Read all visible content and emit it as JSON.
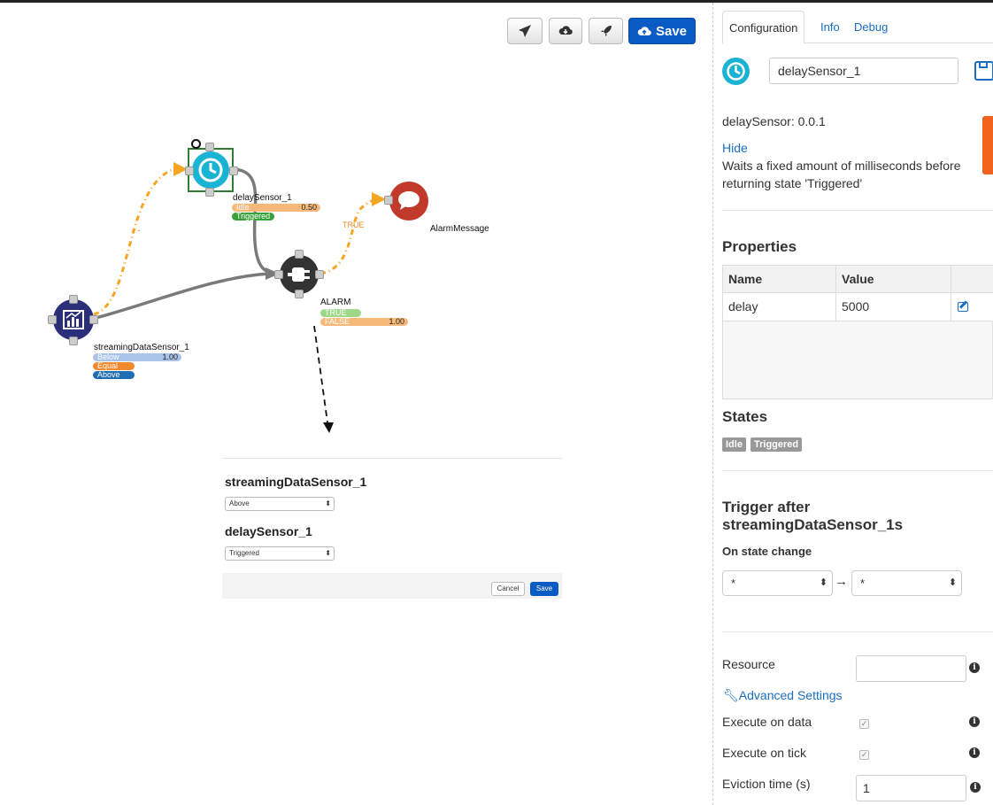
{
  "toolbar": {
    "save_label": "Save",
    "icons": [
      "paper-plane-icon",
      "cloud-download-icon",
      "rocket-icon",
      "cloud-upload-icon"
    ]
  },
  "nodes": {
    "delay": {
      "label": "delaySensor_1",
      "states": [
        {
          "label": "Idle",
          "value": "0.50",
          "color": "#f7b97a"
        },
        {
          "label": "Triggered",
          "value": "",
          "color": "#3aa03a"
        }
      ]
    },
    "alarm_msg": {
      "label": "AlarmMessage"
    },
    "alarm": {
      "label": "ALARM",
      "states": [
        {
          "label": "TRUE",
          "value": "",
          "color": "#9ed98a"
        },
        {
          "label": "FALSE",
          "value": "1.00",
          "color": "#f7b97a"
        }
      ]
    },
    "stream": {
      "label": "streamingDataSensor_1",
      "states": [
        {
          "label": "Below",
          "value": "1.00",
          "color": "#a9c4e8"
        },
        {
          "label": "Equal",
          "value": "",
          "color": "#f08a2c"
        },
        {
          "label": "Above",
          "value": "",
          "color": "#1f6db3"
        }
      ]
    },
    "edge_true_label": "TRUE"
  },
  "popup": {
    "sensor1_title": "streamingDataSensor_1",
    "sensor1_value": "Above",
    "sensor2_title": "delaySensor_1",
    "sensor2_value": "Triggered",
    "cancel_label": "Cancel",
    "save_label": "Save"
  },
  "panel": {
    "tabs": {
      "configuration": "Configuration",
      "info": "Info",
      "debug": "Debug"
    },
    "name_value": "delaySensor_1",
    "version": "delaySensor: 0.0.1",
    "hide_link": "Hide",
    "description": [
      "Waits a fixed amount of milliseconds before",
      "returning state 'Triggered'"
    ],
    "properties_title": "Properties",
    "table": {
      "headers": [
        "Name",
        "Value",
        ""
      ],
      "rows": [
        {
          "name": "delay",
          "value": "5000"
        }
      ]
    },
    "states_title": "States",
    "states": [
      "Idle",
      "Triggered"
    ],
    "trigger_title": [
      "Trigger after",
      "streamingDataSensor_1s"
    ],
    "on_state_change": "On state change",
    "from_state": "*",
    "arrow": "→",
    "to_state": "*",
    "resource_label": "Resource",
    "resource_value": "",
    "advanced_link": "Advanced Settings",
    "execute_on_data": "Execute on data",
    "execute_on_tick": "Execute on tick",
    "eviction_label": "Eviction time (s)",
    "eviction_value": "1",
    "accent_color": "#0a5bc4",
    "link_color": "#1a6dc0",
    "side_tab_color": "#f0641e"
  }
}
